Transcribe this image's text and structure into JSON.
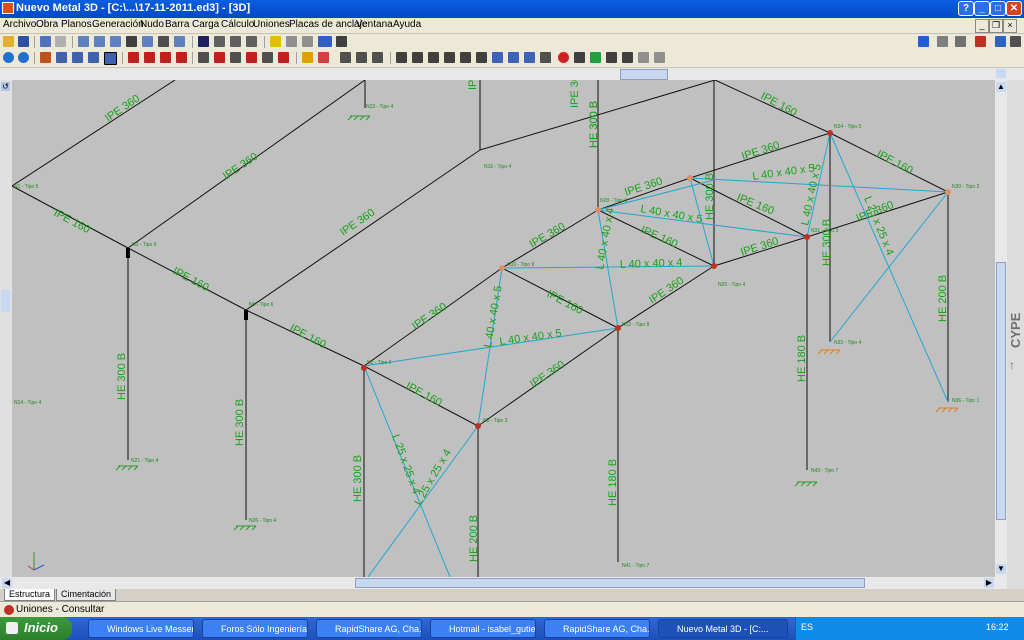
{
  "window": {
    "title": "Nuevo Metal 3D - [C:\\...\\17-11-2011.ed3] - [3D]",
    "help_label": "?",
    "minimize_label": "_",
    "maximize_label": "□",
    "close_label": "✕"
  },
  "menu": [
    "Archivo",
    "Obra",
    "Planos",
    "Generación",
    "Nudo",
    "Barra",
    "Carga",
    "Cálculo",
    "Uniones",
    "Placas de anclaje",
    "Ventana",
    "Ayuda"
  ],
  "side_label": "CYPE",
  "tabs": [
    "Estructura",
    "Cimentación"
  ],
  "status": "Uniones - Consultar",
  "taskbar": {
    "start": "Inicio",
    "tasks": [
      "Windows Live Messen...",
      "Foros Sólo Ingeniería ...",
      "RapidShare AG, Cha...",
      "Hotmail - isabel_gutie...",
      "RapidShare AG, Cha...",
      "Nuevo Metal 3D - [C:..."
    ],
    "lang": "ES",
    "clock": "16:22"
  },
  "model": {
    "member_labels": [
      "IPE 360",
      "IPE 360",
      "IPE 360",
      "IPE 160",
      "IPE 160",
      "IPE 160",
      "HE 300 B",
      "HE 300 B",
      "HE 300 B",
      "IPE 360",
      "IPE 160",
      "IPE 360",
      "IPE 360",
      "L 40 x 40 x 5",
      "L 40 x 40 x 5",
      "L 25 x 25 x 4",
      "HE 200 B",
      "IPE 160",
      "L 40 x 40 x 4",
      "IPE 360",
      "IPE 360",
      "IPE 160",
      "L 40 x 40 x 4",
      "HE 180 B",
      "IPE 360",
      "L 40 x 40 x 5",
      "IPE 160",
      "L 40 x 40 x 5",
      "IPE 360",
      "HE 300 B",
      "IPE 360",
      "IPE 160",
      "L 40 x 40 x 5",
      "HE 300 B",
      "L 25 x 25 x 4",
      "HE 180 B",
      "IPE 160",
      "IPE 360",
      "IPE 160",
      "L 25 x 25 x 4",
      "HE 200 B",
      "HE 300 B",
      "HE 300 B"
    ],
    "node_labels": [
      "N13 - Tipo 4",
      "N15 - Tipo 4",
      "N1 - Tipo 5",
      "N3 - Tipo 6",
      "N5 - Tipo 6",
      "N2 - Tipo 6",
      "N14 - Tipo 4",
      "N21 - Tipo 4",
      "N26 - Tipo 4",
      "N8 - Tipo 3",
      "N10 - Tipo 9",
      "N12 - Tipo 8",
      "N20 - Tipo 4",
      "N34 - Tipo 5",
      "N30 - Tipo 2",
      "N31 - Tipo 3",
      "N36 - Tipo 1",
      "N33 - Tipo 4",
      "N43 - Tipo 7",
      "N41 - Tipo 7",
      "N28 - Tipo 9"
    ]
  }
}
